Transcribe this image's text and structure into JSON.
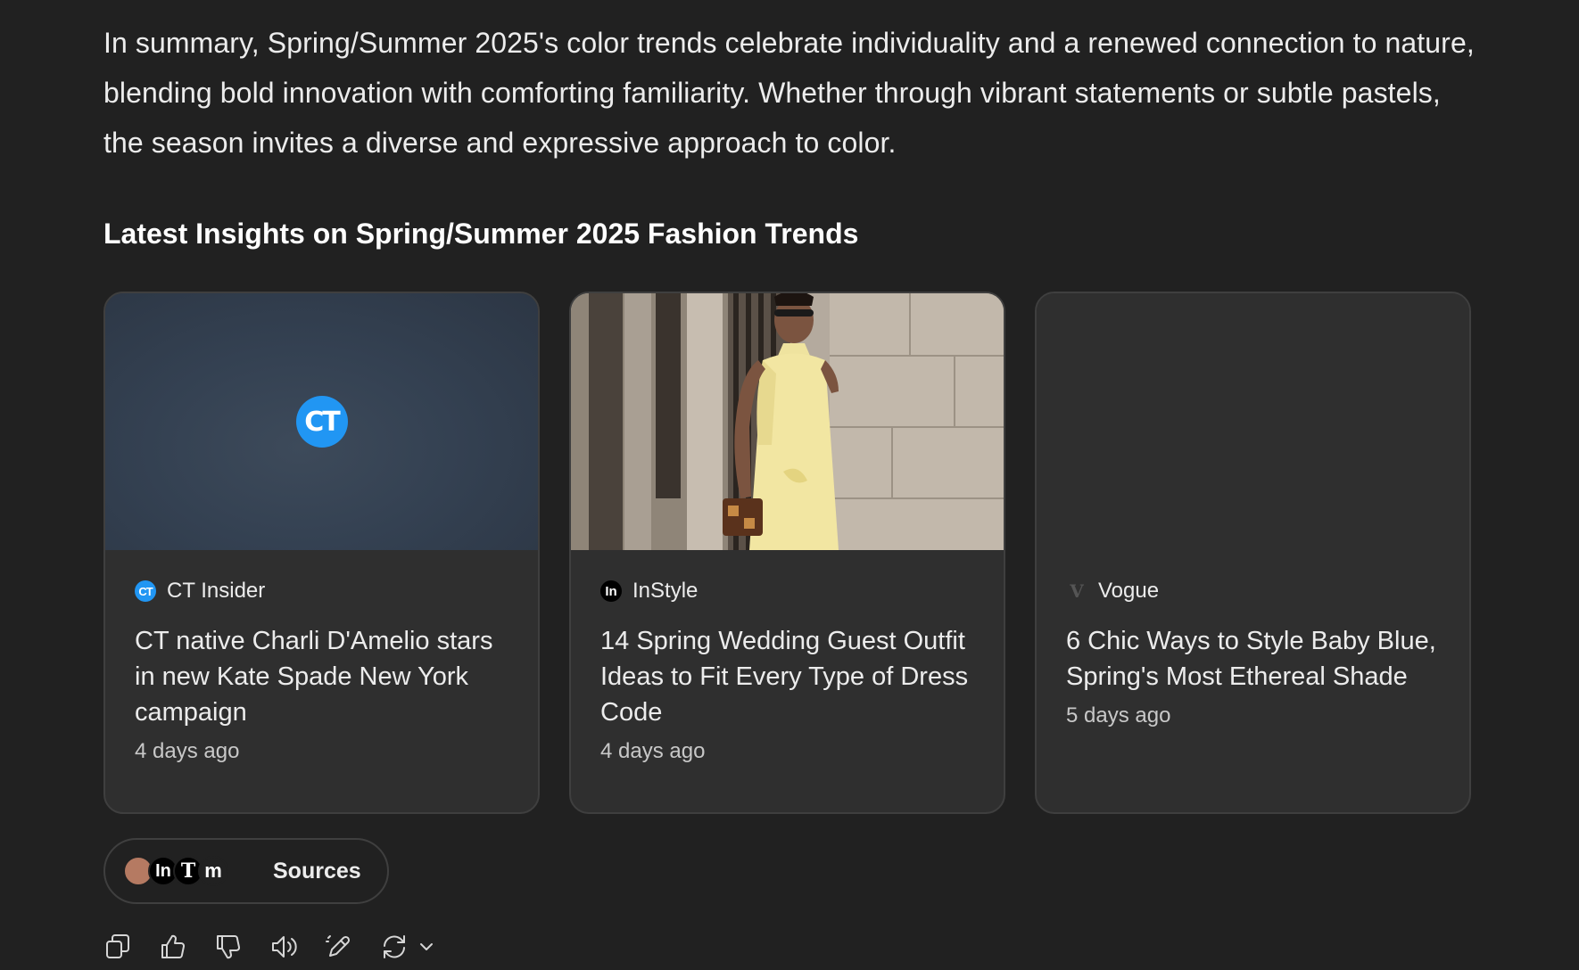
{
  "summary": "In summary, Spring/Summer 2025's color trends celebrate individuality and a renewed connection to nature, blending bold innovation with comforting familiarity. Whether through vibrant statements or subtle pastels, the season invites a diverse and expressive approach to color.",
  "section_title": "Latest Insights on Spring/Summer 2025 Fashion Trends",
  "cards": [
    {
      "logo_text": "CT",
      "source_icon": "CT",
      "source": "CT Insider",
      "title": "CT native Charli D'Amelio stars in new Kate Spade New York campaign",
      "time": "4 days ago"
    },
    {
      "source_icon": "In",
      "source": "InStyle",
      "title": "14 Spring Wedding Guest Outfit Ideas to Fit Every Type of Dress Code",
      "time": "4 days ago"
    },
    {
      "source_icon": "V",
      "source": "Vogue",
      "title": "6 Chic Ways to Style Baby Blue, Spring's Most Ethereal Shade",
      "time": "5 days ago"
    }
  ],
  "sources": {
    "avatars": [
      "",
      "In",
      "T",
      "m"
    ],
    "label": "Sources"
  },
  "actions": [
    "copy-icon",
    "thumbs-up-icon",
    "thumbs-down-icon",
    "speaker-icon",
    "edit-pen-icon",
    "regenerate-icon",
    "chevron-down-icon"
  ],
  "colors": {
    "background": "#212121",
    "card": "#2f2f2f",
    "ct_blue": "#2196f3"
  }
}
